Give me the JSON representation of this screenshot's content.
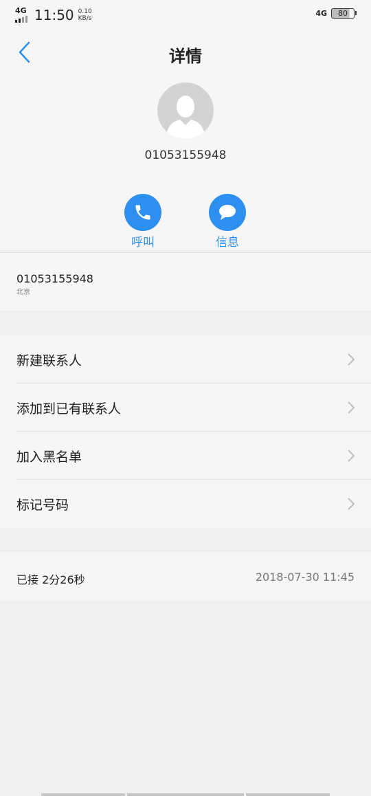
{
  "statusbar": {
    "network_left": "4G",
    "time": "11:50",
    "speed_value": "0.10",
    "speed_unit": "KB/s",
    "network_right": "4G",
    "battery": "80"
  },
  "header": {
    "title": "详情",
    "phone_number": "01053155948"
  },
  "actions": [
    {
      "label": "呼叫",
      "icon": "phone-icon"
    },
    {
      "label": "信息",
      "icon": "message-icon"
    }
  ],
  "number_row": {
    "number": "01053155948",
    "location": "北京"
  },
  "menu": {
    "items": [
      {
        "label": "新建联系人"
      },
      {
        "label": "添加到已有联系人"
      },
      {
        "label": "加入黑名单"
      },
      {
        "label": "标记号码"
      }
    ]
  },
  "call_log": {
    "status": "已接 2分26秒",
    "datetime": "2018-07-30 11:45"
  },
  "colors": {
    "accent": "#2d90f0",
    "background": "#f0f0f0",
    "surface": "#f6f6f6"
  }
}
